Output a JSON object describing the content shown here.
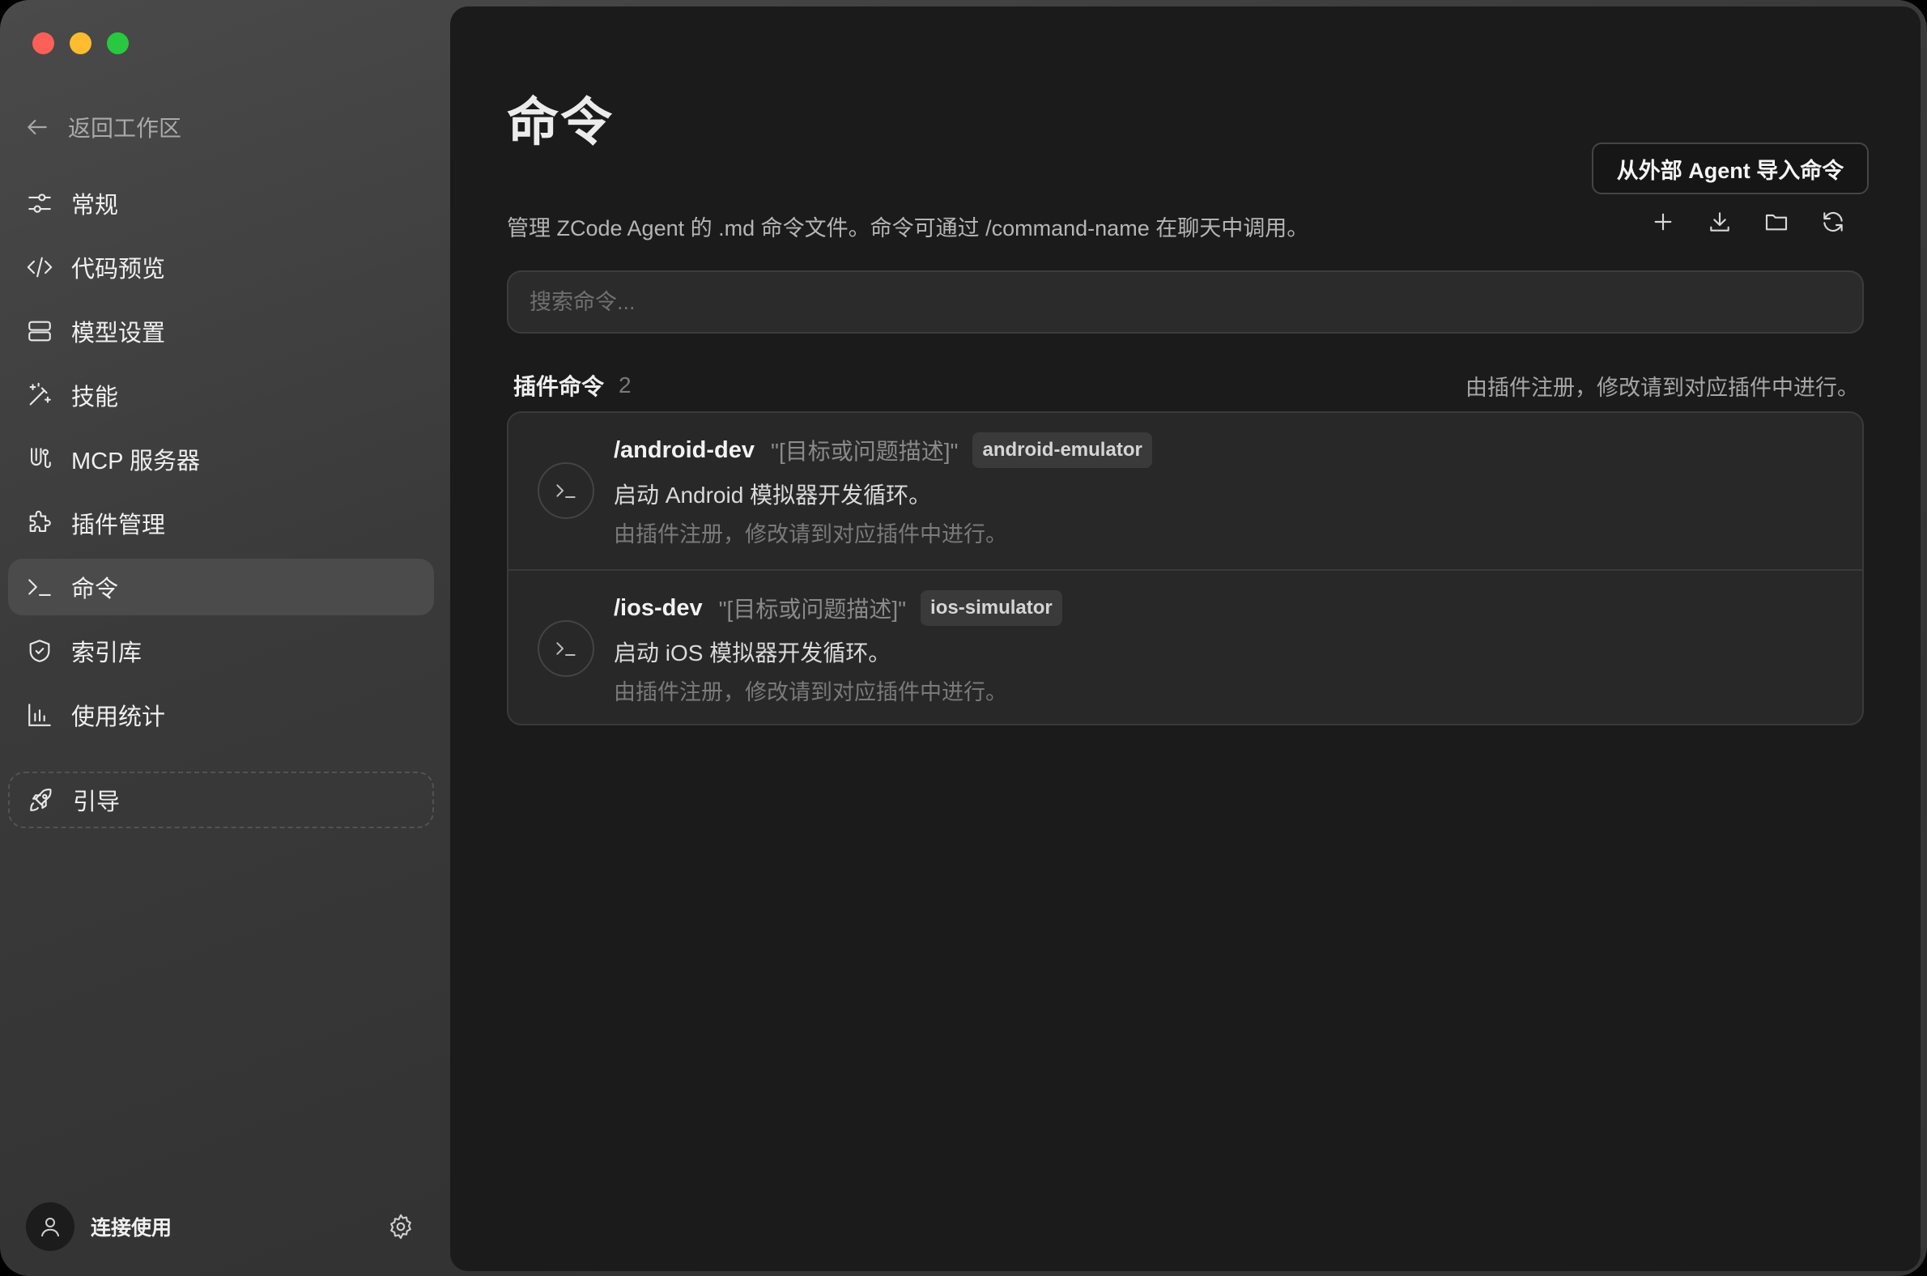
{
  "sidebar": {
    "back_label": "返回工作区",
    "items": [
      {
        "label": "常规",
        "icon": "sliders-icon"
      },
      {
        "label": "代码预览",
        "icon": "code-icon"
      },
      {
        "label": "模型设置",
        "icon": "server-icon"
      },
      {
        "label": "技能",
        "icon": "magic-wand-icon"
      },
      {
        "label": "MCP 服务器",
        "icon": "mcp-icon"
      },
      {
        "label": "插件管理",
        "icon": "puzzle-icon"
      },
      {
        "label": "命令",
        "icon": "terminal-icon",
        "active": true
      },
      {
        "label": "索引库",
        "icon": "shield-icon"
      },
      {
        "label": "使用统计",
        "icon": "bar-chart-icon"
      }
    ],
    "guide_label": "引导",
    "user_label": "连接使用"
  },
  "main": {
    "title": "命令",
    "import_button": "从外部 Agent 导入命令",
    "description": "管理 ZCode Agent 的 .md 命令文件。命令可通过 /command-name 在聊天中调用。",
    "search_placeholder": "搜索命令...",
    "section": {
      "title": "插件命令",
      "count": "2",
      "note": "由插件注册，修改请到对应插件中进行。"
    },
    "commands": [
      {
        "name": "/android-dev",
        "args": "\"[目标或问题描述]\"",
        "tag": "android-emulator",
        "description": "启动 Android 模拟器开发循环。",
        "source": "由插件注册，修改请到对应插件中进行。"
      },
      {
        "name": "/ios-dev",
        "args": "\"[目标或问题描述]\"",
        "tag": "ios-simulator",
        "description": "启动 iOS 模拟器开发循环。",
        "source": "由插件注册，修改请到对应插件中进行。"
      }
    ]
  },
  "colors": {
    "window_bg": "#3a3a3a",
    "main_bg": "#1b1b1b",
    "active_item": "#4b4b4b",
    "traffic_red": "#fe5f57",
    "traffic_yellow": "#febc2e",
    "traffic_green": "#28c840"
  }
}
